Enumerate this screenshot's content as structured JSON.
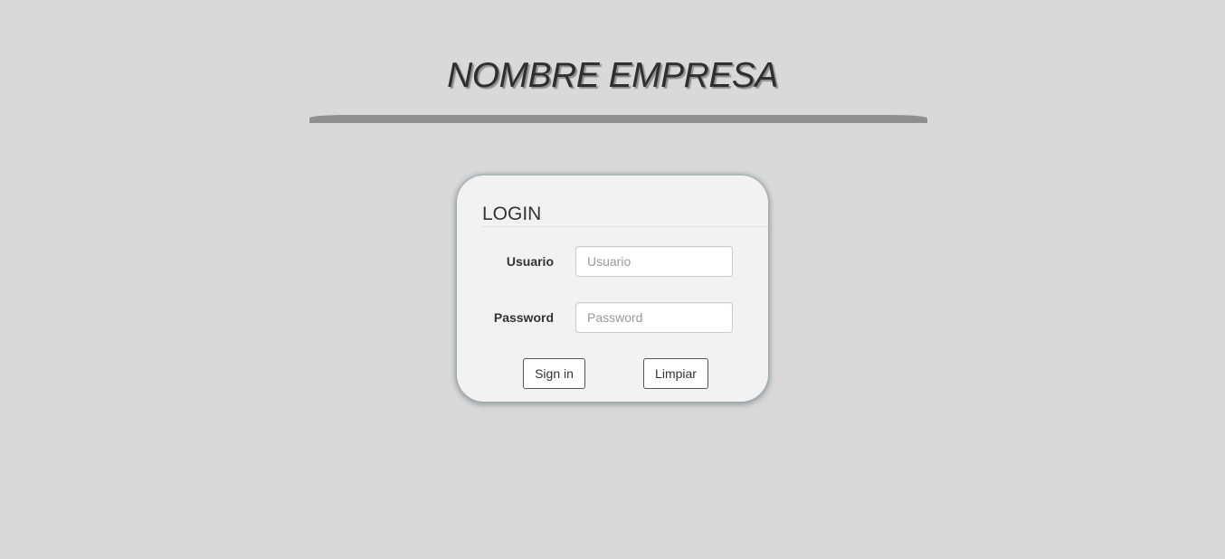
{
  "header": {
    "company_name": "NOMBRE EMPRESA"
  },
  "login": {
    "heading": "LOGIN",
    "username_label": "Usuario",
    "username_placeholder": "Usuario",
    "username_value": "",
    "password_label": "Password",
    "password_placeholder": "Password",
    "password_value": "",
    "signin_label": "Sign in",
    "clear_label": "Limpiar"
  },
  "colors": {
    "background": "#d9d9d9",
    "card": "#f2f2f2",
    "divider": "#8f8f8f",
    "text": "#333333"
  }
}
